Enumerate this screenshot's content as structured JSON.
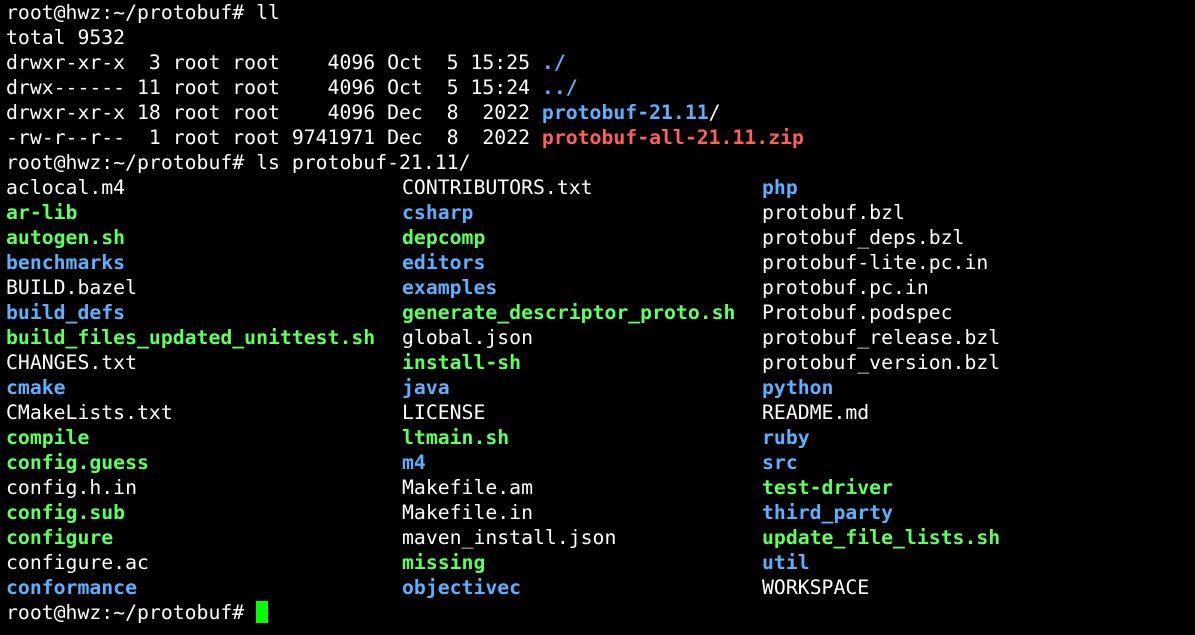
{
  "colors": {
    "background": "#000000",
    "text": "#ffffff",
    "directory": "#5fafff",
    "executable": "#5fff5f",
    "archive": "#ff5f5f",
    "cursor": "#00ff00"
  },
  "prompt": "root@hwz:~/protobuf# ",
  "commands": {
    "first": "ll",
    "second": "ls protobuf-21.11/"
  },
  "total_line": "total 9532",
  "ll_entries": [
    {
      "meta": "drwxr-xr-x  3 root root    4096 Oct  5 15:25 ",
      "name": "./",
      "suffix": "",
      "type": "dir"
    },
    {
      "meta": "drwx------ 11 root root    4096 Oct  5 15:24 ",
      "name": "../",
      "suffix": "",
      "type": "dir"
    },
    {
      "meta": "drwxr-xr-x 18 root root    4096 Dec  8  2022 ",
      "name": "protobuf-21.11",
      "suffix": "/",
      "type": "dir"
    },
    {
      "meta": "-rw-r--r--  1 root root 9741971 Dec  8  2022 ",
      "name": "protobuf-all-21.11.zip",
      "suffix": "",
      "type": "arc"
    }
  ],
  "ls_columns": [
    [
      {
        "name": "aclocal.m4",
        "type": "file"
      },
      {
        "name": "ar-lib",
        "type": "exe"
      },
      {
        "name": "autogen.sh",
        "type": "exe"
      },
      {
        "name": "benchmarks",
        "type": "dir"
      },
      {
        "name": "BUILD.bazel",
        "type": "file"
      },
      {
        "name": "build_defs",
        "type": "dir"
      },
      {
        "name": "build_files_updated_unittest.sh",
        "type": "exe"
      },
      {
        "name": "CHANGES.txt",
        "type": "file"
      },
      {
        "name": "cmake",
        "type": "dir"
      },
      {
        "name": "CMakeLists.txt",
        "type": "file"
      },
      {
        "name": "compile",
        "type": "exe"
      },
      {
        "name": "config.guess",
        "type": "exe"
      },
      {
        "name": "config.h.in",
        "type": "file"
      },
      {
        "name": "config.sub",
        "type": "exe"
      },
      {
        "name": "configure",
        "type": "exe"
      },
      {
        "name": "configure.ac",
        "type": "file"
      },
      {
        "name": "conformance",
        "type": "dir"
      }
    ],
    [
      {
        "name": "CONTRIBUTORS.txt",
        "type": "file"
      },
      {
        "name": "csharp",
        "type": "dir"
      },
      {
        "name": "depcomp",
        "type": "exe"
      },
      {
        "name": "editors",
        "type": "dir"
      },
      {
        "name": "examples",
        "type": "dir"
      },
      {
        "name": "generate_descriptor_proto.sh",
        "type": "exe"
      },
      {
        "name": "global.json",
        "type": "file"
      },
      {
        "name": "install-sh",
        "type": "exe"
      },
      {
        "name": "java",
        "type": "dir"
      },
      {
        "name": "LICENSE",
        "type": "file"
      },
      {
        "name": "ltmain.sh",
        "type": "exe"
      },
      {
        "name": "m4",
        "type": "dir"
      },
      {
        "name": "Makefile.am",
        "type": "file"
      },
      {
        "name": "Makefile.in",
        "type": "file"
      },
      {
        "name": "maven_install.json",
        "type": "file"
      },
      {
        "name": "missing",
        "type": "exe"
      },
      {
        "name": "objectivec",
        "type": "dir"
      }
    ],
    [
      {
        "name": "php",
        "type": "dir"
      },
      {
        "name": "protobuf.bzl",
        "type": "file"
      },
      {
        "name": "protobuf_deps.bzl",
        "type": "file"
      },
      {
        "name": "protobuf-lite.pc.in",
        "type": "file"
      },
      {
        "name": "protobuf.pc.in",
        "type": "file"
      },
      {
        "name": "Protobuf.podspec",
        "type": "file"
      },
      {
        "name": "protobuf_release.bzl",
        "type": "file"
      },
      {
        "name": "protobuf_version.bzl",
        "type": "file"
      },
      {
        "name": "python",
        "type": "dir"
      },
      {
        "name": "README.md",
        "type": "file"
      },
      {
        "name": "ruby",
        "type": "dir"
      },
      {
        "name": "src",
        "type": "dir"
      },
      {
        "name": "test-driver",
        "type": "exe"
      },
      {
        "name": "third_party",
        "type": "dir"
      },
      {
        "name": "update_file_lists.sh",
        "type": "exe"
      },
      {
        "name": "util",
        "type": "dir"
      },
      {
        "name": "WORKSPACE",
        "type": "file"
      }
    ]
  ]
}
